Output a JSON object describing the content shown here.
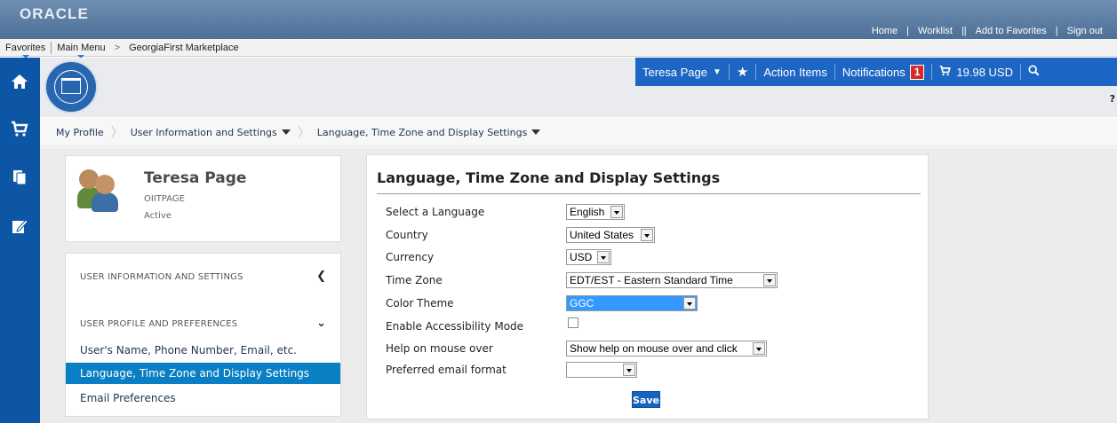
{
  "oracle": {
    "logo": "ORACLE"
  },
  "top_links": {
    "home": "Home",
    "worklist": "Worklist",
    "add_favorites": "Add to Favorites",
    "sign_out": "Sign out"
  },
  "menu_bar": {
    "favorites": "Favorites",
    "main_menu": "Main Menu",
    "crumb_sep": ">",
    "marketplace": "GeorgiaFirst Marketplace"
  },
  "user_bar": {
    "user_name": "Teresa Page",
    "action_items": "Action Items",
    "notifications": "Notifications",
    "notification_count": "1",
    "cart_total": "19.98 USD"
  },
  "help": "?",
  "breadcrumb": {
    "items": [
      "My Profile",
      "User Information and Settings",
      "Language, Time Zone and Display Settings"
    ]
  },
  "profile": {
    "name": "Teresa Page",
    "user_id": "OIITPAGE",
    "status": "Active"
  },
  "side_nav": {
    "section1": "USER INFORMATION AND SETTINGS",
    "section2": "USER PROFILE AND PREFERENCES",
    "links": [
      "User's Name, Phone Number, Email, etc.",
      "Language, Time Zone and Display Settings",
      "Email Preferences"
    ]
  },
  "settings": {
    "title": "Language, Time Zone and Display Settings",
    "fields": [
      {
        "label": "Select a Language",
        "value": "English"
      },
      {
        "label": "Country",
        "value": "United States"
      },
      {
        "label": "Currency",
        "value": "USD"
      },
      {
        "label": "Time Zone",
        "value": "EDT/EST - Eastern Standard Time"
      },
      {
        "label": "Color Theme",
        "value": "GGC"
      },
      {
        "label": "Enable Accessibility Mode",
        "value": ""
      },
      {
        "label": "Help on mouse over",
        "value": "Show help on mouse over and click"
      },
      {
        "label": "Preferred email format",
        "value": ""
      }
    ],
    "accessibility_checked": false,
    "save_label": "Save"
  },
  "colors": {
    "rail": "#0d56a6",
    "user_bar": "#1d66c4",
    "active_nav": "#0b7fc4",
    "badge": "#d42a2a",
    "save": "#1565c0",
    "highlight": "#3399ff"
  },
  "icons": [
    "home-icon",
    "cart-icon",
    "documents-icon",
    "edit-icon",
    "star-icon",
    "search-icon",
    "chevron-left-icon",
    "chevron-down-icon"
  ]
}
